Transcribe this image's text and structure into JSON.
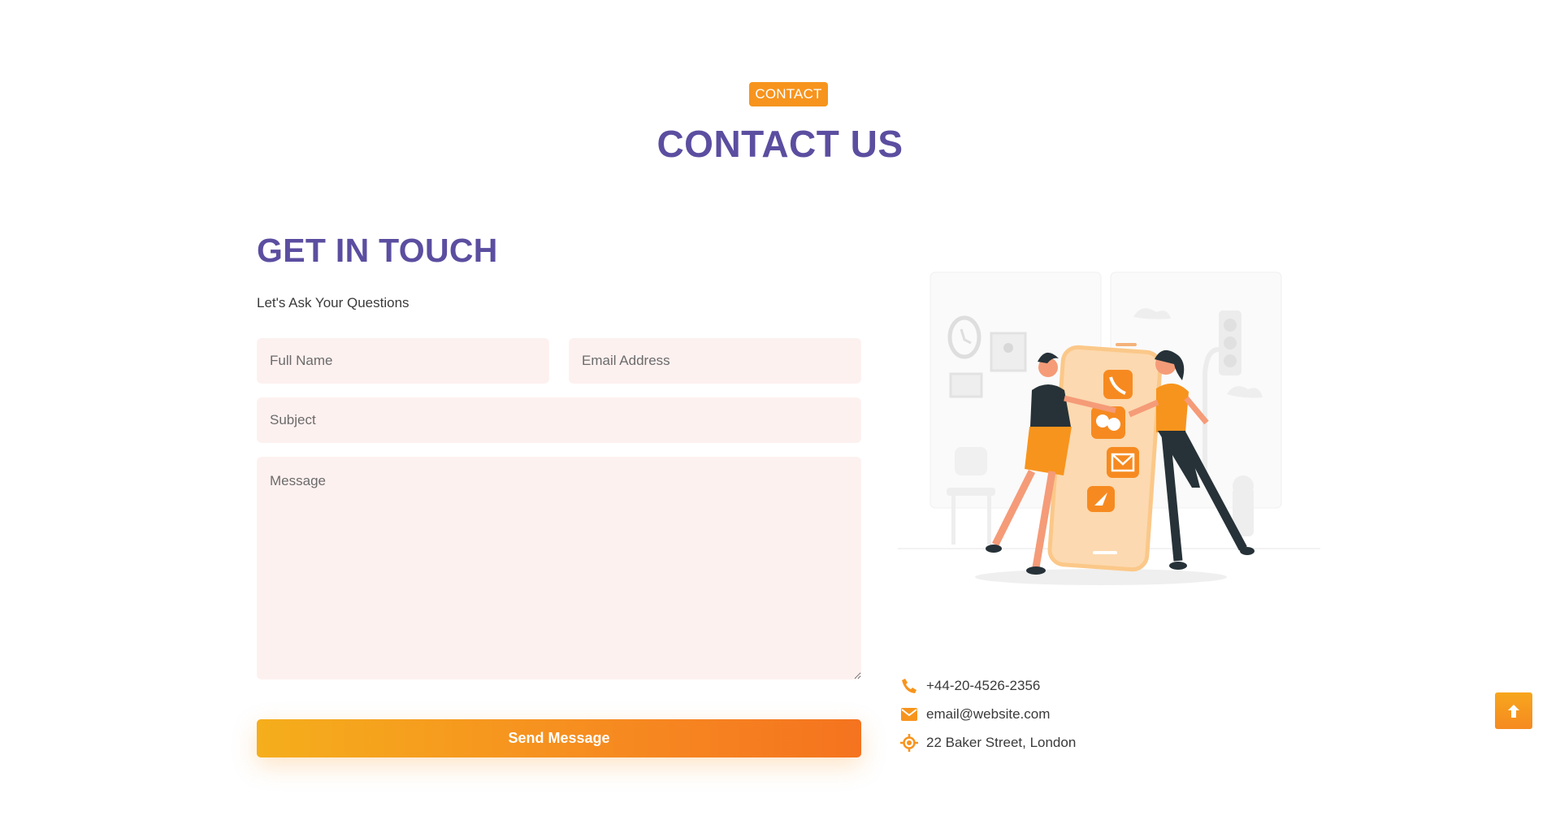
{
  "header": {
    "badge": "CONTACT",
    "title": "CONTACT US"
  },
  "form": {
    "title": "GET IN TOUCH",
    "subtitle": "Let's Ask Your Questions",
    "full_name": {
      "placeholder": "Full Name",
      "value": ""
    },
    "email": {
      "placeholder": "Email Address",
      "value": ""
    },
    "subject": {
      "placeholder": "Subject",
      "value": ""
    },
    "message": {
      "placeholder": "Message",
      "value": ""
    },
    "submit_label": "Send Message"
  },
  "contact_info": {
    "items": [
      {
        "icon": "phone-icon",
        "text": "+44-20-4526-2356"
      },
      {
        "icon": "envelope-icon",
        "text": "email@website.com"
      },
      {
        "icon": "location-icon",
        "text": "22 Baker Street, London"
      }
    ]
  },
  "illustration": {
    "icon": "contact-illustration"
  },
  "scroll_top": {
    "icon": "arrow-up-icon"
  },
  "colors": {
    "accent": "#f7941d",
    "heading": "#5b4ea0",
    "field_bg": "#fdf1f0",
    "text": "#3a3a3a"
  }
}
